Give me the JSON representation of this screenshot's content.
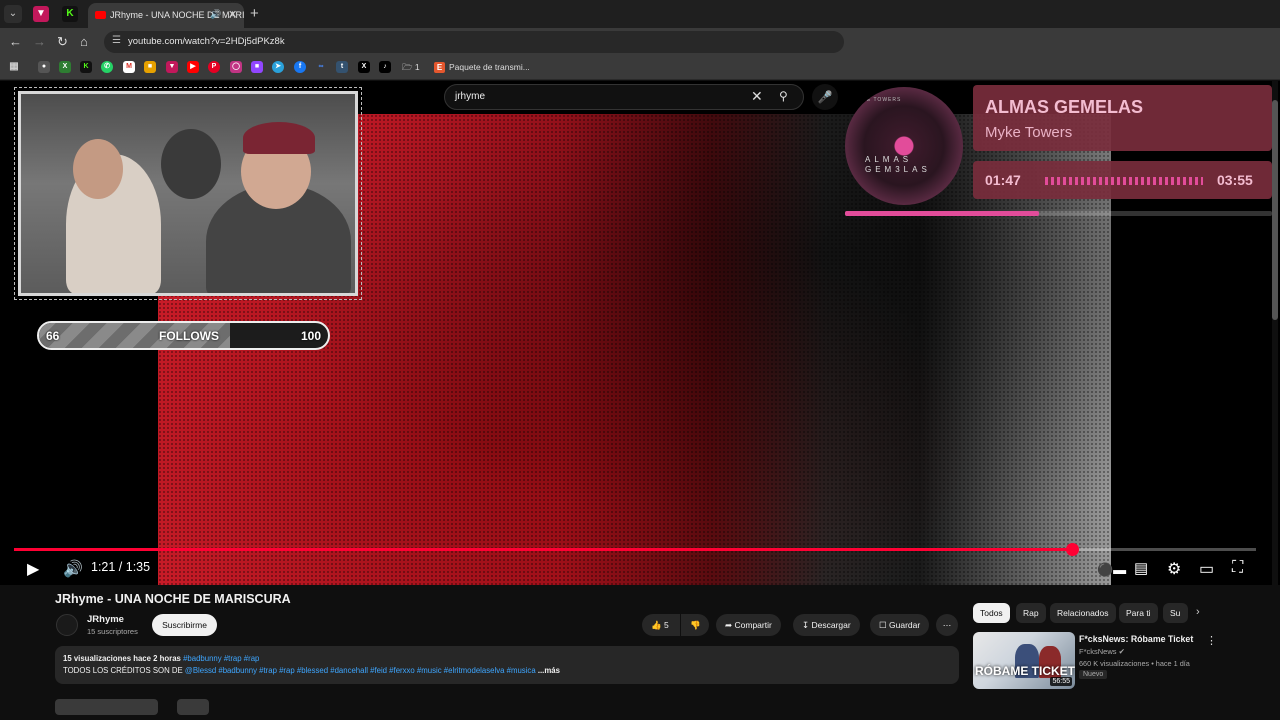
{
  "browser": {
    "active_tab_title": "JRhyme - UNA NOCHE DE MARISCURA",
    "url": "youtube.com/watch?v=2HDj5dPKz8k",
    "bookmark_folder": "1",
    "bookmark_paquete": "Paquete de transmi..."
  },
  "youtube": {
    "search_query": "jrhyme"
  },
  "overlay": {
    "follows_current": "66",
    "follows_label": "FOLLOWS",
    "follows_goal": "100",
    "follows_fraction": 0.66,
    "now_playing_song": "ALMAS GEMELAS",
    "now_playing_artist": "Myke Towers",
    "now_playing_elapsed": "01:47",
    "now_playing_total": "03:55",
    "now_playing_fraction": 0.455,
    "disc_text_1": "ALMAS",
    "disc_text_2": "GEM3LAS",
    "disc_artist": "MYKE TOWERS",
    "accent_color": "#e24c9a"
  },
  "player": {
    "time_display": "1:21 / 1:35",
    "progress_fraction": 0.852,
    "progress_color": "#ff0033"
  },
  "video": {
    "title": "JRhyme - UNA NOCHE DE MARISCURA",
    "channel_name": "JRhyme",
    "subscribers": "15 suscriptores",
    "subscribe_label": "Suscribirme",
    "like_count": "5",
    "share_label": "Compartir",
    "download_label": "Descargar",
    "save_label": "Guardar",
    "description_stats": "15 visualizaciones  hace 2 horas",
    "description_tags_1": "#badbunny #trap #rap",
    "description_text": "TODOS LOS CRÉDITOS SON DE",
    "description_tags_2": "@Blessd #badbunny #trap #rap #blessed #dancehall #feid #ferxxo #music #elritmodelaselva #musica",
    "description_more": "...más"
  },
  "sidebar": {
    "chips": [
      "Todos",
      "Rap",
      "Relacionados",
      "Para ti",
      "Su"
    ],
    "recommended": {
      "title": "F*cksNews: Róbame Ticket",
      "channel": "F*cksNews",
      "meta": "660 K visualizaciones • hace 1 día",
      "badge": "Nuevo",
      "duration": "56:55",
      "thumb_text": "RÓBAME TICKET"
    }
  }
}
